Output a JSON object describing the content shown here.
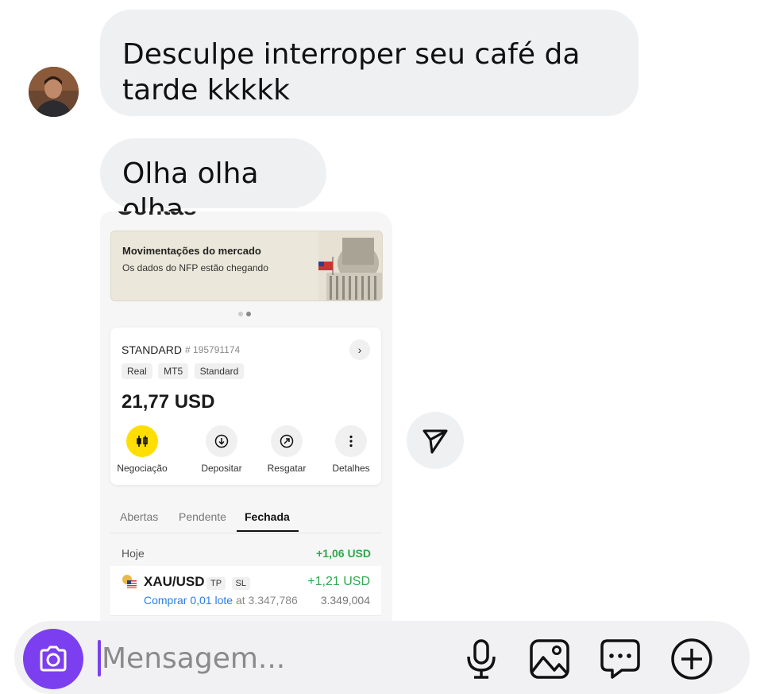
{
  "messages": [
    {
      "text": "Desculpe interroper seu café da tarde kkkkk"
    },
    {
      "text": "Olha olha olha"
    }
  ],
  "shared_screenshot": {
    "cut_title": "Contas",
    "banner": {
      "title": "Movimentações do mercado",
      "subtitle": "Os dados do NFP estão chegando"
    },
    "account": {
      "type": "STANDARD",
      "number": "# 195791174",
      "tags": [
        "Real",
        "MT5",
        "Standard"
      ],
      "balance": "21,77 USD",
      "actions": [
        {
          "label": "Negociação",
          "icon": "candlestick-icon"
        },
        {
          "label": "Depositar",
          "icon": "download-icon"
        },
        {
          "label": "Resgatar",
          "icon": "withdraw-icon"
        },
        {
          "label": "Detalhes",
          "icon": "more-vertical-icon"
        }
      ]
    },
    "tabs": [
      "Abertas",
      "Pendente",
      "Fechada"
    ],
    "active_tab": "Fechada",
    "today": {
      "label": "Hoje",
      "value": "+1,06 USD"
    },
    "trade": {
      "symbol": "XAU/USD",
      "badges": [
        "TP",
        "SL"
      ],
      "pnl": "+1,21 USD",
      "order_action": "Comprar 0,01 lote",
      "order_at": "at 3.347,786",
      "current_price": "3.349,004"
    }
  },
  "composer": {
    "placeholder": "Mensagem...",
    "icons": [
      "camera-icon",
      "microphone-icon",
      "gallery-icon",
      "sticker-chat-icon",
      "plus-circle-icon"
    ]
  },
  "colors": {
    "accent": "#7b3ff0",
    "bubble": "#eff0f2",
    "positive": "#2fa84f",
    "link": "#2b7de9",
    "trade_button": "#ffde02"
  }
}
